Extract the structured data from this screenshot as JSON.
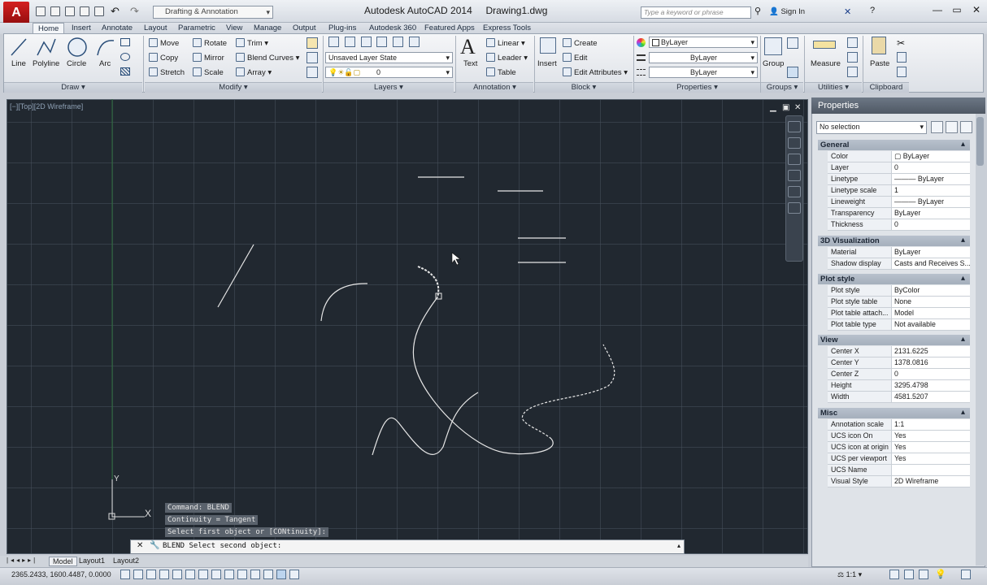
{
  "titlebar": {
    "app_name": "Autodesk AutoCAD 2014",
    "file_name": "Drawing1.dwg",
    "workspace": "Drafting & Annotation",
    "search_placeholder": "Type a keyword or phrase",
    "sign_in": "Sign In"
  },
  "tabs": [
    "Home",
    "Insert",
    "Annotate",
    "Layout",
    "Parametric",
    "View",
    "Manage",
    "Output",
    "Plug-ins",
    "Autodesk 360",
    "Featured Apps",
    "Express Tools"
  ],
  "ribbon": {
    "draw": {
      "line": "Line",
      "polyline": "Polyline",
      "circle": "Circle",
      "arc": "Arc",
      "title": "Draw"
    },
    "modify": {
      "move": "Move",
      "rotate": "Rotate",
      "trim": "Trim",
      "copy": "Copy",
      "mirror": "Mirror",
      "blend": "Blend Curves",
      "stretch": "Stretch",
      "scale": "Scale",
      "array": "Array",
      "title": "Modify"
    },
    "layers": {
      "state": "Unsaved Layer State",
      "current": "0",
      "title": "Layers"
    },
    "annotation": {
      "text": "Text",
      "linear": "Linear",
      "leader": "Leader",
      "table": "Table",
      "title": "Annotation"
    },
    "block": {
      "insert": "Insert",
      "create": "Create",
      "edit": "Edit",
      "edit_attr": "Edit Attributes",
      "title": "Block"
    },
    "properties": {
      "color": "ByLayer",
      "linetype": "ByLayer",
      "lineweight": "ByLayer",
      "title": "Properties"
    },
    "groups": {
      "group": "Group",
      "title": "Groups"
    },
    "utilities": {
      "measure": "Measure",
      "title": "Utilities"
    },
    "clipboard": {
      "paste": "Paste",
      "title": "Clipboard"
    }
  },
  "viewport": {
    "label": "[−][Top][2D Wireframe]",
    "axis_x": "X",
    "axis_y": "Y"
  },
  "command": {
    "history": [
      "Command:  BLEND",
      "Continuity = Tangent",
      "Select first object or [CONtinuity]:"
    ],
    "prompt": "BLEND Select second object:"
  },
  "layout_tabs": [
    "Model",
    "Layout1",
    "Layout2"
  ],
  "status": {
    "coords": "2365.2433, 1600.4487, 0.0000",
    "scale": "1:1"
  },
  "properties": {
    "title": "Properties",
    "selection": "No selection",
    "sections": [
      {
        "name": "General",
        "rows": [
          [
            "Color",
            "ByLayer"
          ],
          [
            "Layer",
            "0"
          ],
          [
            "Linetype",
            "ByLayer"
          ],
          [
            "Linetype scale",
            "1"
          ],
          [
            "Lineweight",
            "ByLayer"
          ],
          [
            "Transparency",
            "ByLayer"
          ],
          [
            "Thickness",
            "0"
          ]
        ]
      },
      {
        "name": "3D Visualization",
        "rows": [
          [
            "Material",
            "ByLayer"
          ],
          [
            "Shadow display",
            "Casts and Receives S..."
          ]
        ]
      },
      {
        "name": "Plot style",
        "rows": [
          [
            "Plot style",
            "ByColor"
          ],
          [
            "Plot style table",
            "None"
          ],
          [
            "Plot table attach...",
            "Model"
          ],
          [
            "Plot table type",
            "Not available"
          ]
        ]
      },
      {
        "name": "View",
        "rows": [
          [
            "Center X",
            "2131.6225"
          ],
          [
            "Center Y",
            "1378.0816"
          ],
          [
            "Center Z",
            "0"
          ],
          [
            "Height",
            "3295.4798"
          ],
          [
            "Width",
            "4581.5207"
          ]
        ]
      },
      {
        "name": "Misc",
        "rows": [
          [
            "Annotation scale",
            "1:1"
          ],
          [
            "UCS icon On",
            "Yes"
          ],
          [
            "UCS icon at origin",
            "Yes"
          ],
          [
            "UCS per viewport",
            "Yes"
          ],
          [
            "UCS Name",
            ""
          ],
          [
            "Visual Style",
            "2D Wireframe"
          ]
        ]
      }
    ]
  },
  "colors": {
    "canvas": "#212830",
    "accent": "#c41a1a",
    "palette_header": "#4f5864"
  }
}
